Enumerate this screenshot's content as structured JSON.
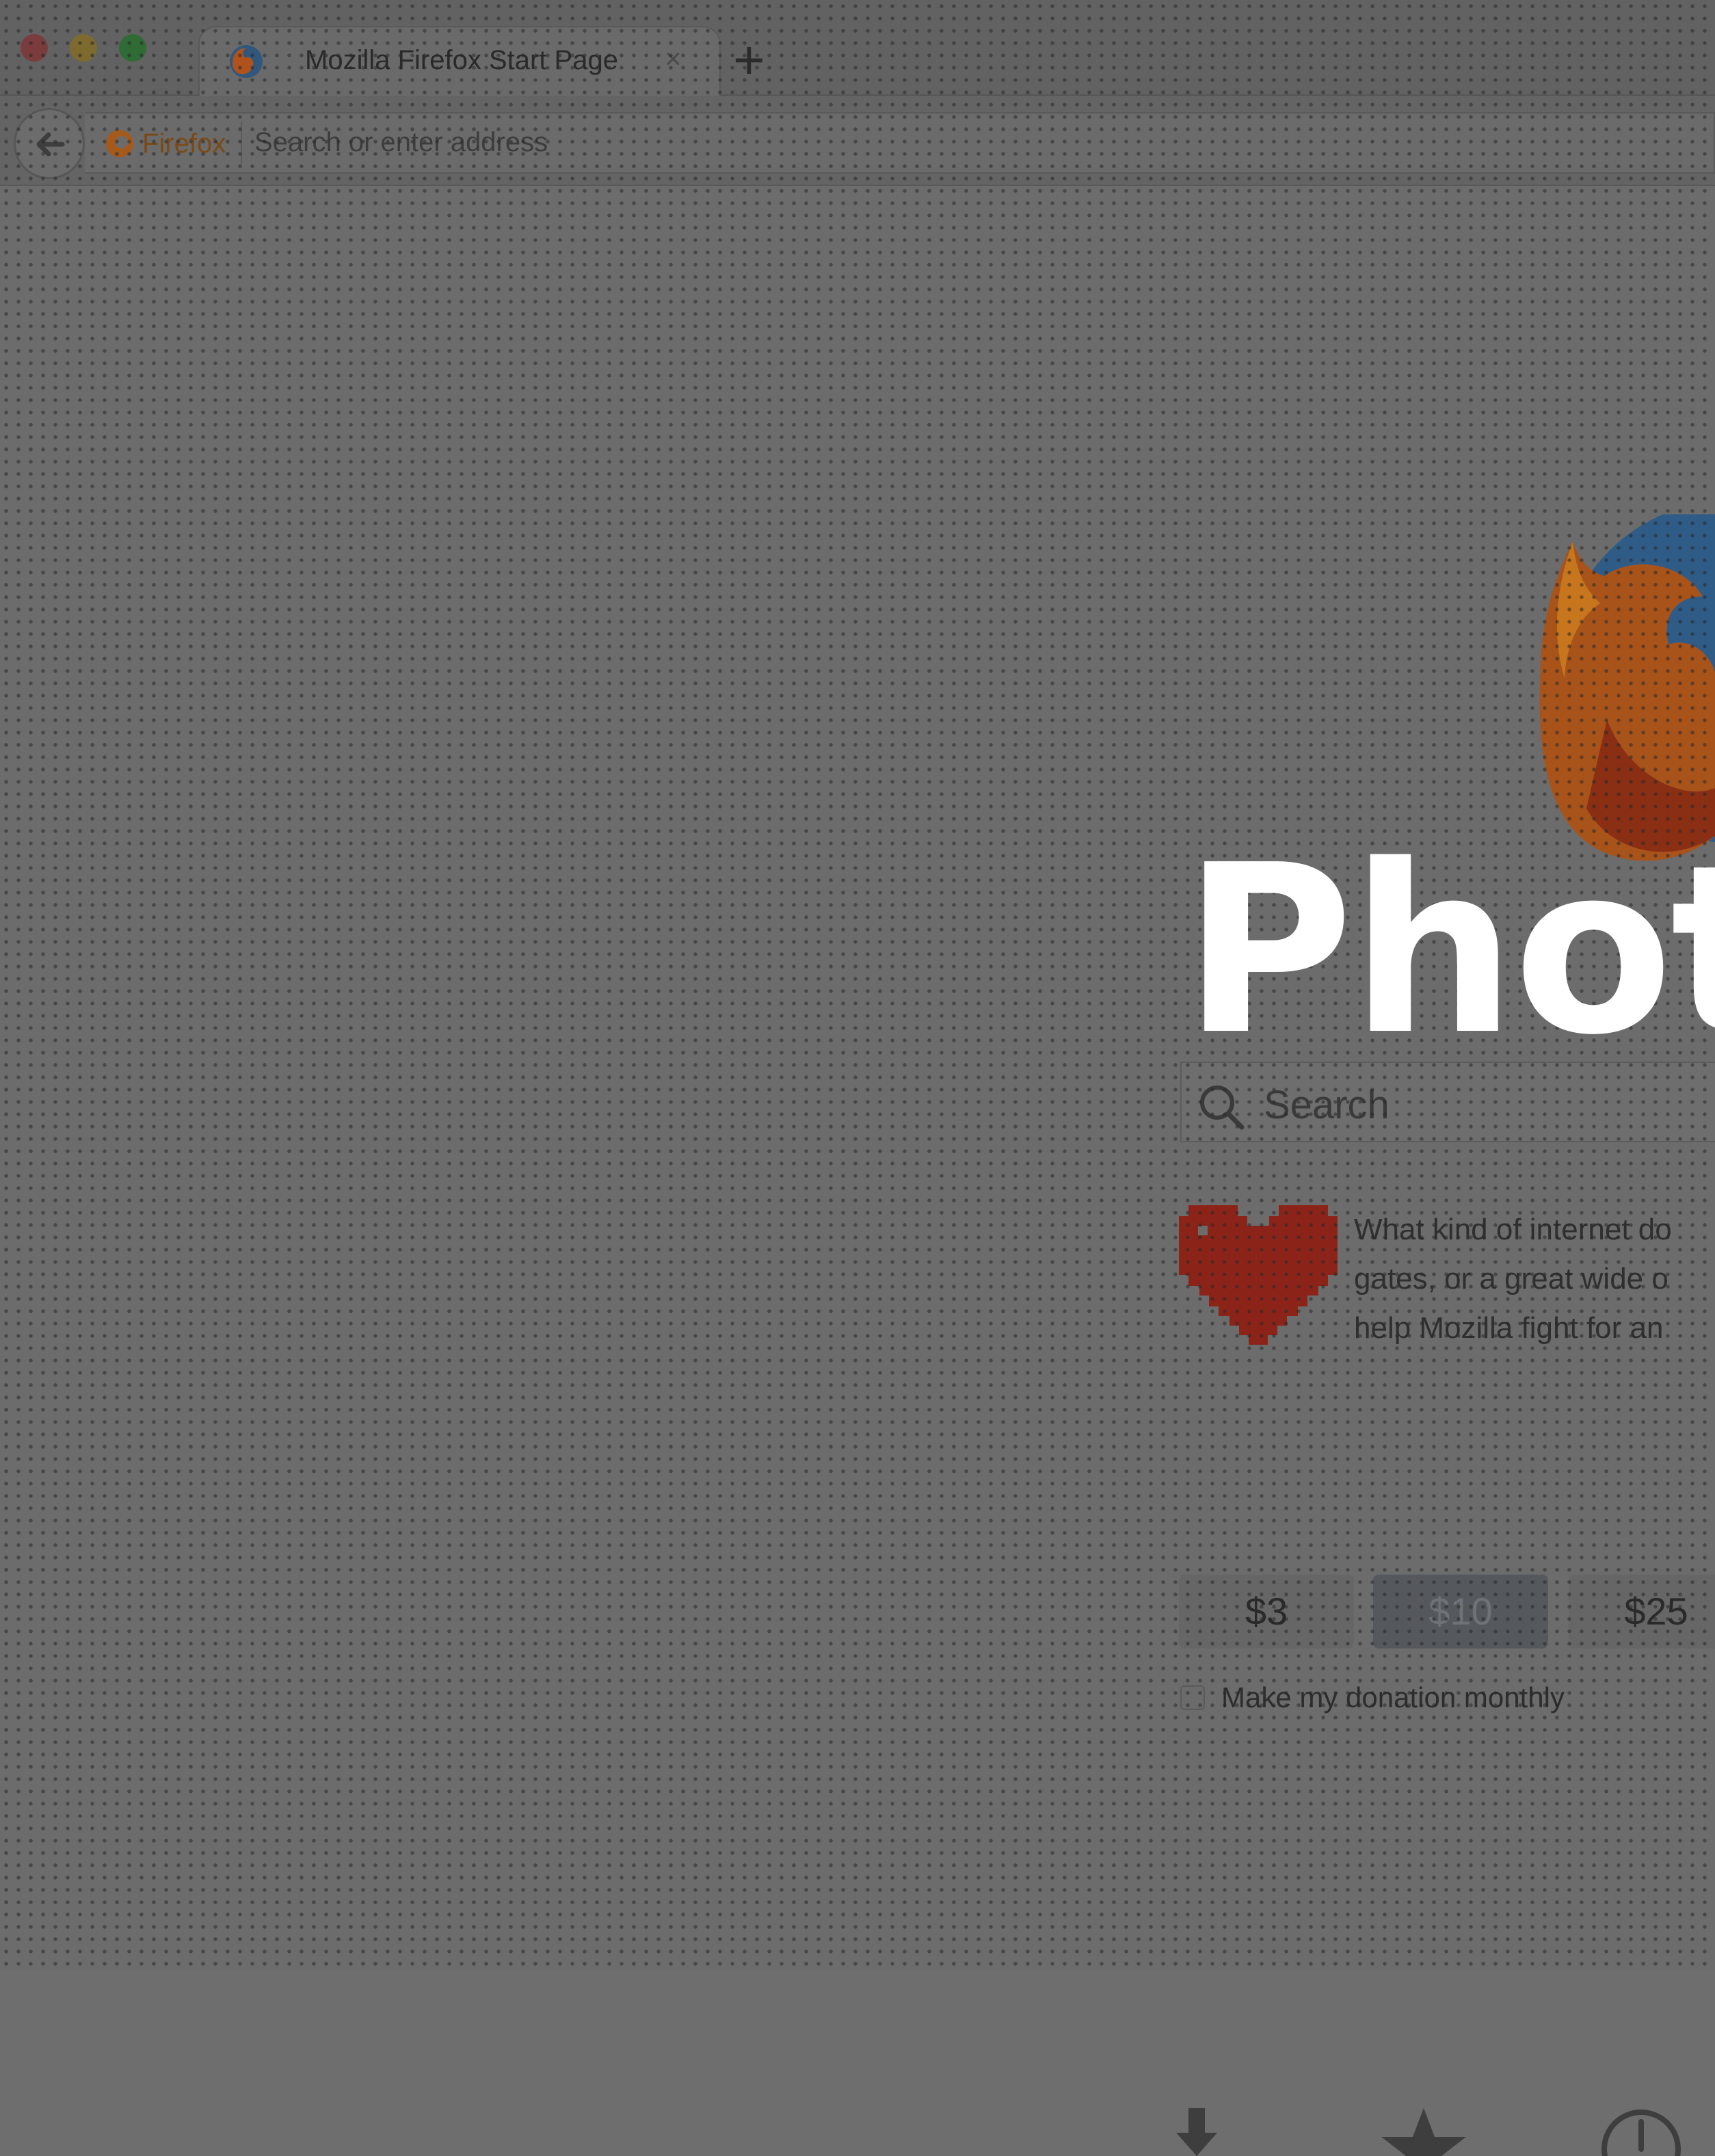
{
  "window": {
    "tab": {
      "title": "Mozilla Firefox Start Page",
      "close": "×",
      "favicon": "firefox-logo-icon"
    },
    "new_tab": "+"
  },
  "toolbar": {
    "back": "back-arrow-icon",
    "identity_label": "Firefox",
    "url_placeholder": "Search or enter address"
  },
  "page": {
    "search_placeholder": "Search",
    "snippet": {
      "icon": "heart-icon",
      "lines": [
        "What kind of internet do",
        "gates, or a great wide o",
        "help Mozilla fight for an"
      ]
    },
    "donation": {
      "amounts": [
        "$3",
        "$10",
        "$25"
      ],
      "selected": "$10",
      "monthly_label": "Make my donation monthly",
      "monthly_checked": false
    },
    "launcher_icons": [
      "downloads-icon",
      "bookmarks-icon",
      "history-icon"
    ]
  },
  "overlay": {
    "watermark": "Phot"
  },
  "colors": {
    "overlay": "#6c6c6c",
    "watermark": "#ffffff",
    "firefox_orange": "#c0531a",
    "firefox_blue": "#2e5c8a",
    "heart": "#9a2a1e"
  }
}
